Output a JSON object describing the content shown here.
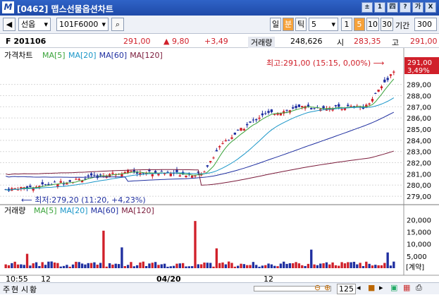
{
  "window": {
    "title": "[0462] 맵스선물옵션차트",
    "logo_letter": "M",
    "buttons": [
      "±",
      "1",
      "四",
      "?",
      "가",
      "X"
    ]
  },
  "toolbar": {
    "code_select": "선옵",
    "code_value": "101F6000",
    "intervals": [
      "일",
      "분",
      "틱"
    ],
    "active_interval": "분",
    "interval_value": "5",
    "periods": [
      "1",
      "5",
      "10",
      "30"
    ],
    "active_period": "5",
    "period_label": "기간",
    "period_value": "300"
  },
  "info": {
    "name": "F 201106",
    "price": "291,00",
    "change": "▲ 9,80",
    "change_pct": "+3,49",
    "volume_label": "거래량",
    "volume": "248,626",
    "open_label": "시",
    "open": "283,35",
    "high_label": "고",
    "high": "291,00"
  },
  "price_pane": {
    "title": "가격차트",
    "mas": [
      {
        "label": "MA[5]",
        "color": "#3aa33a"
      },
      {
        "label": "MA[20]",
        "color": "#1a96c8"
      },
      {
        "label": "MA[60]",
        "color": "#1f2fa0"
      },
      {
        "label": "MA[120]",
        "color": "#7a1a3a"
      }
    ],
    "high_note": "최고:291,00 (15:15, 0,00%)",
    "low_note": "최저:279,20 (11:20, +4,23%)",
    "current_price": "291,00",
    "current_pct": "3,49%"
  },
  "volume_pane": {
    "title": "거래량",
    "mas": [
      {
        "label": "MA[5]",
        "color": "#3aa33a"
      },
      {
        "label": "MA[20]",
        "color": "#1a96c8"
      },
      {
        "label": "MA[60]",
        "color": "#1f2fa0"
      },
      {
        "label": "MA[120]",
        "color": "#7a1a3a"
      }
    ],
    "unit_label": "[계약]"
  },
  "price_axis": [
    "291,00",
    "289,00",
    "288,00",
    "287,00",
    "286,00",
    "285,00",
    "284,00",
    "283,00",
    "282,00",
    "281,00",
    "280,00",
    "279,00"
  ],
  "volume_axis": [
    "20,000",
    "15,000",
    "10,000",
    "5,000"
  ],
  "time_axis": [
    "10:55",
    "12",
    "04/20",
    "12"
  ],
  "status": {
    "items": [
      "주",
      "현",
      "시",
      "황"
    ],
    "zoom": "125"
  },
  "chart_data": {
    "type": "candlestick",
    "y_range": [
      278.5,
      291.5
    ],
    "volume_range": [
      0,
      21000
    ],
    "ohlc": [],
    "volumes": []
  }
}
